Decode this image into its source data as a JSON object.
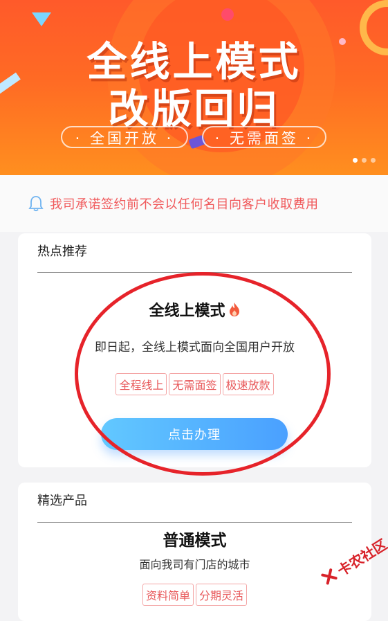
{
  "banner": {
    "title_line1": "全线上模式",
    "title_line2": "改版回归",
    "pill1": "· 全国开放 ·",
    "pill2": "· 无需面签 ·",
    "indicator_count": 3,
    "active_indicator": 1
  },
  "notice": {
    "icon": "bell-icon",
    "text": "我司承诺签约前不会以任何名目向客户收取费用",
    "color": "#f0595b"
  },
  "hot": {
    "header": "热点推荐",
    "product": {
      "title": "全线上模式",
      "icon": "flame-icon",
      "description": "即日起，全线上模式面向全国用户开放",
      "tags": [
        "全程线上",
        "无需面签",
        "极速放款"
      ],
      "button_label": "点击办理"
    }
  },
  "featured": {
    "header": "精选产品",
    "product": {
      "title": "普通模式",
      "description": "面向我司有门店的城市",
      "tags": [
        "资料简单",
        "分期灵活"
      ]
    }
  },
  "watermark": {
    "text": "卡农社区"
  },
  "colors": {
    "accent_blue": "#4aa0ff",
    "tag_red": "#e8585a",
    "banner_orange": "#ff6a24",
    "annotation_red": "#e6232a"
  }
}
